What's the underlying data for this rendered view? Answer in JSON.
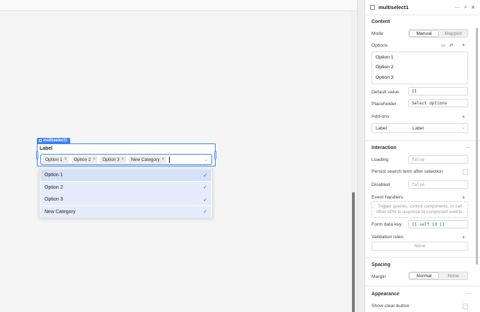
{
  "widget": {
    "tag": "multiselect1",
    "label": "Label",
    "chips": [
      "Option 1",
      "Option 2",
      "Option 3",
      "New Category"
    ],
    "chip_remove": "×",
    "arrow": "⌄"
  },
  "dropdown": {
    "items": [
      "Option 1",
      "Option 2",
      "Option 3",
      "New Category"
    ],
    "check": "✓"
  },
  "panel": {
    "title": "multiselect1",
    "header_icons": [
      "more-icon",
      "search-icon",
      "close-icon"
    ],
    "content": {
      "title": "Content",
      "mode_label": "Mode",
      "mode_options": [
        "Manual",
        "Mapped"
      ],
      "options_label": "Options",
      "options": [
        "Option 1",
        "Option 2",
        "Option 3"
      ],
      "default_label": "Default value",
      "default_value": "[]",
      "placeholder_label": "Placeholder",
      "placeholder_value": "Select options",
      "addons_label": "Add-ons",
      "addon_key": "Label",
      "addon_value": "Label"
    },
    "interaction": {
      "title": "Interaction",
      "loading_label": "Loading",
      "loading_value": "false",
      "persist_label": "Persist search term after selection",
      "disabled_label": "Disabled",
      "disabled_value": "false",
      "events_label": "Event handlers",
      "events_hint": "Trigger queries, control components, or call other APIs in response to component events.",
      "formkey_label": "Form data key",
      "formkey_value": "{{ self.id }}",
      "validation_label": "Validation rules",
      "validation_value": "None"
    },
    "spacing": {
      "title": "Spacing",
      "margin_label": "Margin",
      "margin_options": [
        "Normal",
        "None"
      ]
    },
    "appearance": {
      "title": "Appearance",
      "clear_label": "Show clear button"
    }
  },
  "colors": {
    "accent": "#3b82f6",
    "selected_row": "#e5ecfb",
    "code": "#0f7b55"
  }
}
